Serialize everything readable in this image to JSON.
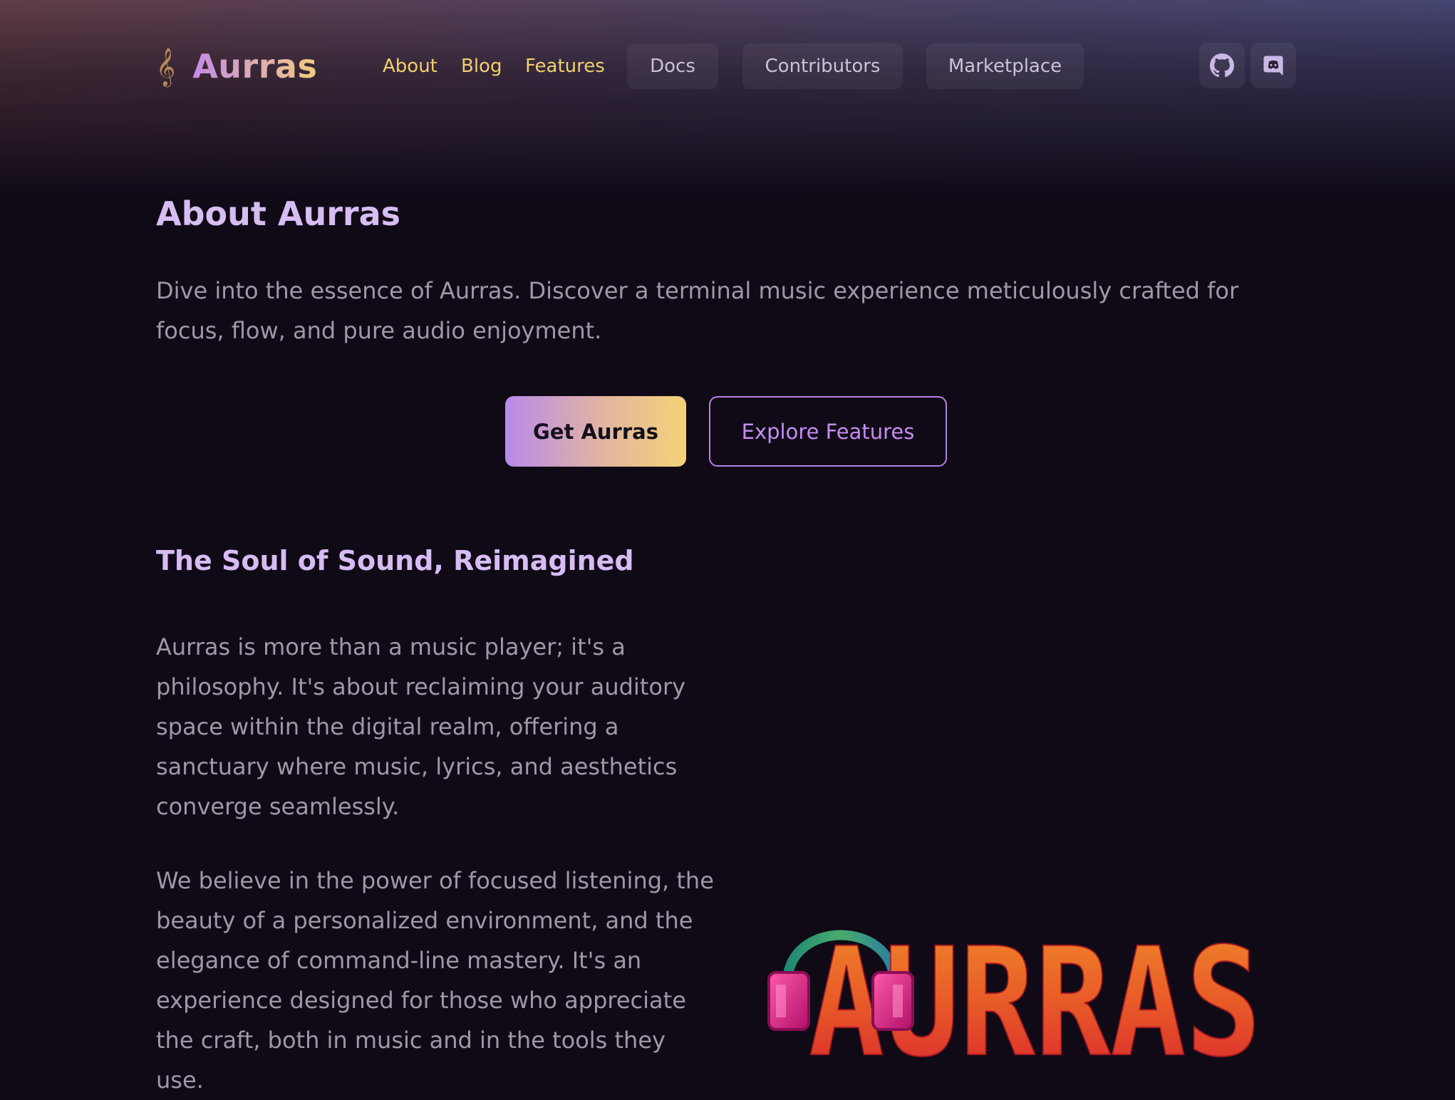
{
  "nav": {
    "brand_icon": "𝄞",
    "brand_name": "Aurras",
    "links": [
      {
        "label": "About"
      },
      {
        "label": "Blog"
      },
      {
        "label": "Features"
      }
    ],
    "pills": [
      {
        "label": "Docs"
      },
      {
        "label": "Contributors"
      },
      {
        "label": "Marketplace"
      }
    ],
    "icons": [
      "github-icon",
      "discord-icon"
    ]
  },
  "hero": {
    "title": "About Aurras",
    "intro": "Dive into the essence of Aurras. Discover a terminal music experience meticulously crafted for focus, flow, and pure audio enjoyment.",
    "primary_button": "Get Aurras",
    "secondary_button": "Explore Features"
  },
  "section": {
    "title": "The Soul of Sound, Reimagined",
    "paragraphs": [
      "Aurras is more than a music player; it's a philosophy. It's about reclaiming your auditory space within the digital realm, offering a sanctuary where music, lyrics, and aesthetics converge seamlessly.",
      "We believe in the power of focused listening, the beauty of a personalized environment, and the elegance of command-line mastery. It's an experience designed for those who appreciate the craft, both in music and in the tools they use."
    ],
    "logo_text": "AURRAS"
  },
  "colors": {
    "background": "#100a17",
    "accent_purple": "#c58ae8",
    "accent_gold": "#f3cd7c",
    "nav_link": "#f0cf6c",
    "heading": "#d6bdf2",
    "body_text": "#9f98a9"
  }
}
